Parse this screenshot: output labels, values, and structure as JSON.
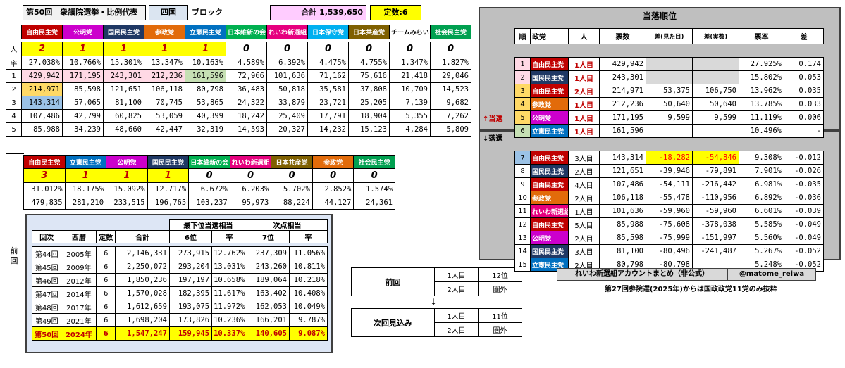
{
  "header": {
    "title": "第50回　衆議院選挙・比例代表",
    "region": "四国",
    "block": "ブロック",
    "total_label": "合計 1,539,650",
    "seats_label": "定数:6"
  },
  "current": {
    "parties": [
      {
        "name": "自由民主党",
        "bg": "#c00000",
        "fg": "#ffffff"
      },
      {
        "name": "公明党",
        "bg": "#cc00cc",
        "fg": "#ffffff"
      },
      {
        "name": "国民民主党",
        "bg": "#1f3864",
        "fg": "#ffffff"
      },
      {
        "name": "参政党",
        "bg": "#e26b0a",
        "fg": "#ffffff"
      },
      {
        "name": "立憲民主党",
        "bg": "#0070c0",
        "fg": "#ffffff"
      },
      {
        "name": "日本維新の会",
        "bg": "#00b050",
        "fg": "#ffffff"
      },
      {
        "name": "れいわ新選組",
        "bg": "#e6007e",
        "fg": "#ffffff"
      },
      {
        "name": "日本保守党",
        "bg": "#00b0f0",
        "fg": "#ffffff"
      },
      {
        "name": "日本共産党",
        "bg": "#7f6000",
        "fg": "#ffffff"
      },
      {
        "name": "チームみらい",
        "bg": "#ffffff",
        "fg": "#000000"
      },
      {
        "name": "社会民主党",
        "bg": "#00a050",
        "fg": "#ffffff"
      }
    ],
    "row_labels": [
      "人",
      "率",
      "1",
      "2",
      "3",
      "4",
      "5"
    ],
    "seats": [
      "2",
      "1",
      "1",
      "1",
      "1",
      "0",
      "0",
      "0",
      "0",
      "0",
      "0"
    ],
    "rates": [
      "27.038%",
      "10.766%",
      "15.301%",
      "13.347%",
      "10.163%",
      "4.589%",
      "6.392%",
      "4.475%",
      "4.755%",
      "1.347%",
      "1.827%"
    ],
    "quotients": [
      [
        "429,942",
        "171,195",
        "243,301",
        "212,236",
        "161,596",
        "72,966",
        "101,636",
        "71,162",
        "75,616",
        "21,418",
        "29,046"
      ],
      [
        "214,971",
        "85,598",
        "121,651",
        "106,118",
        "80,798",
        "36,483",
        "50,818",
        "35,581",
        "37,808",
        "10,709",
        "14,523"
      ],
      [
        "143,314",
        "57,065",
        "81,100",
        "70,745",
        "53,865",
        "24,322",
        "33,879",
        "23,721",
        "25,205",
        "7,139",
        "9,682"
      ],
      [
        "107,486",
        "42,799",
        "60,825",
        "53,059",
        "40,399",
        "18,242",
        "25,409",
        "17,791",
        "18,904",
        "5,355",
        "7,262"
      ],
      [
        "85,988",
        "34,239",
        "48,660",
        "42,447",
        "32,319",
        "14,593",
        "20,327",
        "14,232",
        "15,123",
        "4,284",
        "5,809"
      ]
    ]
  },
  "previous": {
    "side_label": "前回",
    "parties": [
      {
        "name": "自由民主党",
        "bg": "#c00000",
        "fg": "#ffffff"
      },
      {
        "name": "立憲民主党",
        "bg": "#0070c0",
        "fg": "#ffffff"
      },
      {
        "name": "公明党",
        "bg": "#cc00cc",
        "fg": "#ffffff"
      },
      {
        "name": "国民民主党",
        "bg": "#1f3864",
        "fg": "#ffffff"
      },
      {
        "name": "日本維新の会",
        "bg": "#00b050",
        "fg": "#ffffff"
      },
      {
        "name": "れいわ新選組",
        "bg": "#e6007e",
        "fg": "#ffffff"
      },
      {
        "name": "日本共産党",
        "bg": "#7f6000",
        "fg": "#ffffff"
      },
      {
        "name": "参政党",
        "bg": "#e26b0a",
        "fg": "#ffffff"
      },
      {
        "name": "社会民主党",
        "bg": "#00a050",
        "fg": "#ffffff"
      }
    ],
    "seats": [
      "3",
      "1",
      "1",
      "1",
      "0",
      "0",
      "0",
      "0",
      "0"
    ],
    "rates": [
      "31.012%",
      "18.175%",
      "15.092%",
      "12.717%",
      "6.672%",
      "6.203%",
      "5.702%",
      "2.852%",
      "1.574%"
    ],
    "votes": [
      "479,835",
      "281,210",
      "233,515",
      "196,765",
      "103,237",
      "95,973",
      "88,224",
      "44,127",
      "24,361"
    ]
  },
  "history": {
    "group_lowest": "最下位当選相当",
    "group_next": "次点相当",
    "headers": [
      "回次",
      "西暦",
      "定数",
      "合計",
      "6位",
      "率",
      "7位",
      "率"
    ],
    "rows": [
      [
        "第44回",
        "2005年",
        "6",
        "2,146,331",
        "273,915",
        "12.762%",
        "237,309",
        "11.056%"
      ],
      [
        "第45回",
        "2009年",
        "6",
        "2,250,072",
        "293,204",
        "13.031%",
        "243,260",
        "10.811%"
      ],
      [
        "第46回",
        "2012年",
        "6",
        "1,850,236",
        "197,197",
        "10.658%",
        "189,064",
        "10.218%"
      ],
      [
        "第47回",
        "2014年",
        "6",
        "1,570,028",
        "182,395",
        "11.617%",
        "163,402",
        "10.408%"
      ],
      [
        "第48回",
        "2017年",
        "6",
        "1,612,659",
        "193,075",
        "11.972%",
        "162,053",
        "10.049%"
      ],
      [
        "第49回",
        "2021年",
        "6",
        "1,698,204",
        "173,826",
        "10.236%",
        "166,201",
        "9.787%"
      ],
      [
        "第50回",
        "2024年",
        "6",
        "1,547,247",
        "159,945",
        "10.337%",
        "140,605",
        "9.087%"
      ]
    ]
  },
  "reiwa": {
    "prev_label": "前回",
    "prev_rows": [
      [
        "1人目",
        "12位"
      ],
      [
        "2人目",
        "圏外"
      ]
    ],
    "arrow": "↓",
    "next_label": "次回見込み",
    "next_rows": [
      [
        "1人目",
        "11位"
      ],
      [
        "2人目",
        "圏外"
      ]
    ]
  },
  "ranking": {
    "title": "当落順位",
    "headers": [
      "順",
      "政党",
      "人",
      "票数",
      "差(見た目)",
      "差(実数)",
      "票率",
      "差"
    ],
    "elected_label": "↑当選",
    "defeated_label": "↓落選",
    "rows": [
      {
        "rank": "1",
        "party": "自由民主党",
        "pbg": "#c00000",
        "n": "1人目",
        "votes": "429,942",
        "d1": "",
        "d2": "",
        "rate": "27.925%",
        "diff": "0.174"
      },
      {
        "rank": "2",
        "party": "国民民主党",
        "pbg": "#1f3864",
        "n": "1人目",
        "votes": "243,301",
        "d1": "",
        "d2": "",
        "rate": "15.802%",
        "diff": "0.053"
      },
      {
        "rank": "3",
        "party": "自由民主党",
        "pbg": "#c00000",
        "n": "2人目",
        "votes": "214,971",
        "d1": "53,375",
        "d2": "106,750",
        "rate": "13.962%",
        "diff": "0.035"
      },
      {
        "rank": "4",
        "party": "参政党",
        "pbg": "#e26b0a",
        "n": "1人目",
        "votes": "212,236",
        "d1": "50,640",
        "d2": "50,640",
        "rate": "13.785%",
        "diff": "0.033"
      },
      {
        "rank": "5",
        "party": "公明党",
        "pbg": "#cc00cc",
        "n": "1人目",
        "votes": "171,195",
        "d1": "9,599",
        "d2": "9,599",
        "rate": "11.119%",
        "diff": "0.006"
      },
      {
        "rank": "6",
        "party": "立憲民主党",
        "pbg": "#0070c0",
        "n": "1人目",
        "votes": "161,596",
        "d1": "",
        "d2": "",
        "rate": "10.496%",
        "diff": "-"
      },
      {
        "rank": "7",
        "party": "自由民主党",
        "pbg": "#c00000",
        "n": "3人目",
        "votes": "143,314",
        "d1": "-18,282",
        "d2": "-54,846",
        "rate": "9.308%",
        "diff": "-0.012"
      },
      {
        "rank": "8",
        "party": "国民民主党",
        "pbg": "#1f3864",
        "n": "2人目",
        "votes": "121,651",
        "d1": "-39,946",
        "d2": "-79,891",
        "rate": "7.901%",
        "diff": "-0.026"
      },
      {
        "rank": "9",
        "party": "自由民主党",
        "pbg": "#c00000",
        "n": "4人目",
        "votes": "107,486",
        "d1": "-54,111",
        "d2": "-216,442",
        "rate": "6.981%",
        "diff": "-0.035"
      },
      {
        "rank": "10",
        "party": "参政党",
        "pbg": "#e26b0a",
        "n": "2人目",
        "votes": "106,118",
        "d1": "-55,478",
        "d2": "-110,956",
        "rate": "6.892%",
        "diff": "-0.036"
      },
      {
        "rank": "11",
        "party": "れいわ新選組",
        "pbg": "#e6007e",
        "n": "1人目",
        "votes": "101,636",
        "d1": "-59,960",
        "d2": "-59,960",
        "rate": "6.601%",
        "diff": "-0.039"
      },
      {
        "rank": "12",
        "party": "自由民主党",
        "pbg": "#c00000",
        "n": "5人目",
        "votes": "85,988",
        "d1": "-75,608",
        "d2": "-378,038",
        "rate": "5.585%",
        "diff": "-0.049"
      },
      {
        "rank": "13",
        "party": "公明党",
        "pbg": "#cc00cc",
        "n": "2人目",
        "votes": "85,598",
        "d1": "-75,999",
        "d2": "-151,997",
        "rate": "5.560%",
        "diff": "-0.049"
      },
      {
        "rank": "14",
        "party": "国民民主党",
        "pbg": "#1f3864",
        "n": "3人目",
        "votes": "81,100",
        "d1": "-80,496",
        "d2": "-241,487",
        "rate": "5.267%",
        "diff": "-0.052"
      },
      {
        "rank": "15",
        "party": "立憲民主党",
        "pbg": "#0070c0",
        "n": "2人目",
        "votes": "80,798",
        "d1": "-80,798",
        "d2": "",
        "rate": "5.248%",
        "diff": "-0.052"
      }
    ]
  },
  "footer": {
    "account_title": "れいわ新選組アカウントまとめ（非公式）",
    "account_handle": "@matome_reiwa",
    "note": "第27回参院選(2025年)からは国政政党11党のみ抜粋"
  },
  "colors": {
    "seat_yellow": "#ffff00",
    "pink_rank": "#ffd9e5",
    "green_rank": "#c6e0b4",
    "orange_rank": "#ffd966",
    "blue_rank": "#9bc2e6",
    "panel_gray": "#bfbfbf",
    "history_bg": "#dde6f5",
    "diff_yellow": "#ffff00",
    "diff_red": "#ff0000"
  }
}
